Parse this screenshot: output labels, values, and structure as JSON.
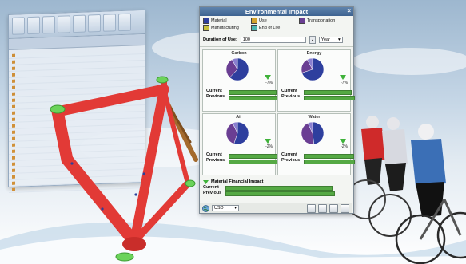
{
  "panel": {
    "title": "Environmental Impact",
    "legend": [
      {
        "label": "Material",
        "color": "#2e3f9e"
      },
      {
        "label": "Use",
        "color": "#d3a12b"
      },
      {
        "label": "Transportation",
        "color": "#6a3e93"
      },
      {
        "label": "Manufacturing",
        "color": "#c9c23b"
      },
      {
        "label": "End of Life",
        "color": "#4bb5b0"
      }
    ],
    "duration_label": "Duration of Use:",
    "duration_value": "100",
    "duration_unit": "Year",
    "tiles": [
      {
        "title": "Carbon",
        "pct": "-7%",
        "current_label": "Current",
        "previous_label": "Previous",
        "current_fraction": 0.93,
        "previous_fraction": 1.0,
        "slices": [
          {
            "value": 62,
            "color": "#2e3f9e"
          },
          {
            "value": 30,
            "color": "#6a3e93"
          },
          {
            "value": 8,
            "color": "#8a7fd0"
          }
        ]
      },
      {
        "title": "Energy",
        "pct": "-7%",
        "current_label": "Current",
        "previous_label": "Previous",
        "current_fraction": 0.93,
        "previous_fraction": 1.0,
        "slices": [
          {
            "value": 70,
            "color": "#2e3f9e"
          },
          {
            "value": 22,
            "color": "#6a3e93"
          },
          {
            "value": 8,
            "color": "#8a7fd0"
          }
        ]
      },
      {
        "title": "Air",
        "pct": "-2%",
        "current_label": "Current",
        "previous_label": "Previous",
        "current_fraction": 0.98,
        "previous_fraction": 1.0,
        "slices": [
          {
            "value": 55,
            "color": "#2e3f9e"
          },
          {
            "value": 38,
            "color": "#6a3e93"
          },
          {
            "value": 7,
            "color": "#8a7fd0"
          }
        ]
      },
      {
        "title": "Water",
        "pct": "-2%",
        "current_label": "Current",
        "previous_label": "Previous",
        "current_fraction": 0.98,
        "previous_fraction": 1.0,
        "slices": [
          {
            "value": 48,
            "color": "#2e3f9e"
          },
          {
            "value": 45,
            "color": "#6a3e93"
          },
          {
            "value": 7,
            "color": "#8a7fd0"
          }
        ]
      }
    ],
    "mfi_label": "Material Financial Impact",
    "mfi_current_label": "Current",
    "mfi_previous_label": "Previous",
    "mfi_current_fraction": 0.88,
    "mfi_previous_fraction": 0.9,
    "currency": "USD"
  },
  "colors": {
    "bar_green": "#55a944",
    "frame_red": "#e23a36",
    "frame_joint_green": "#6bd35a",
    "rear_brown": "#a46a2c",
    "title_blue": "#3d6290"
  }
}
